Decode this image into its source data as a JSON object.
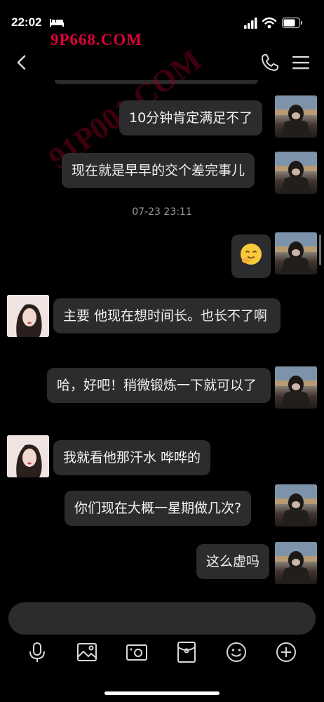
{
  "status_bar": {
    "time": "22:02",
    "watermark": "9P668.COM",
    "icons": [
      "bed-icon",
      "signal-icon",
      "wifi-icon",
      "battery-icon"
    ]
  },
  "nav": {
    "icons": [
      "back-icon",
      "phone-icon",
      "menu-icon"
    ]
  },
  "background_watermark": "91P001.COM",
  "messages": [
    {
      "sender": "me",
      "text": "10分钟肯定满足不了"
    },
    {
      "sender": "me",
      "text": "现在就是早早的交个差完事儿"
    },
    {
      "type": "timestamp",
      "text": "07-23 23:11"
    },
    {
      "sender": "me",
      "text": "🤭"
    },
    {
      "sender": "her",
      "text": "主要 他现在想时间长。也长不了啊"
    },
    {
      "sender": "me",
      "text": "哈，好吧！稍微锻炼一下就可以了"
    },
    {
      "sender": "her",
      "text": "我就看他那汗水 哗哗的"
    },
    {
      "sender": "me",
      "text": "你们现在大概一星期做几次?"
    },
    {
      "sender": "me",
      "text": "这么虚吗"
    }
  ],
  "input": {
    "placeholder": "",
    "toolbar": [
      "microphone-icon",
      "image-icon",
      "camera-icon",
      "red-packet-icon",
      "emoji-icon",
      "plus-icon"
    ]
  },
  "colors": {
    "background": "#000000",
    "bubble": "#2c2c2e",
    "text": "#f2f2f2",
    "timestamp": "#9a9a9a",
    "watermark": "#e0003a"
  }
}
